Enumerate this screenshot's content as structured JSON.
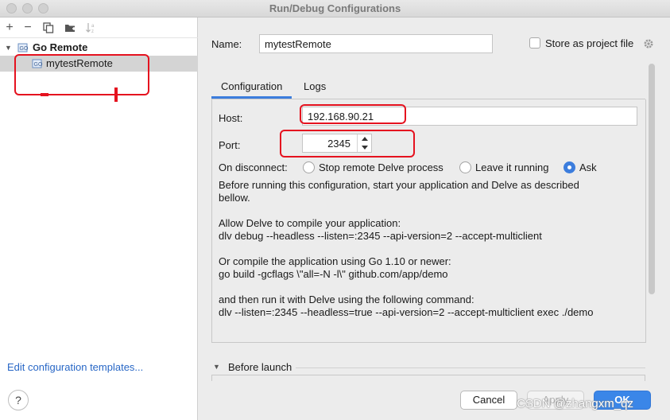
{
  "window": {
    "title": "Run/Debug Configurations"
  },
  "sidebar": {
    "group_label": "Go Remote",
    "selected_item": "mytestRemote",
    "edit_templates_link": "Edit configuration templates..."
  },
  "form": {
    "name_label": "Name:",
    "name_value": "mytestRemote",
    "store_label": "Store as project file",
    "tabs": [
      {
        "label": "Configuration",
        "active": true
      },
      {
        "label": "Logs",
        "active": false
      }
    ],
    "host_label": "Host:",
    "host_value": "192.168.90.21",
    "port_label": "Port:",
    "port_value": "2345",
    "disconnect_label": "On disconnect:",
    "disconnect_options": [
      {
        "label": "Stop remote Delve process",
        "checked": false
      },
      {
        "label": "Leave it running",
        "checked": false
      },
      {
        "label": "Ask",
        "checked": true
      }
    ],
    "description": {
      "intro": "Before running this configuration, start your application and Delve as described\nbellow.",
      "allow_title": "Allow Delve to compile your application:",
      "allow_cmd": "dlv debug --headless --listen=:2345 --api-version=2 --accept-multiclient",
      "compile_title": "Or compile the application using Go 1.10 or newer:",
      "compile_cmd": "go build -gcflags \\\"all=-N -l\\\" github.com/app/demo",
      "run_title": "and then run it with Delve using the following command:",
      "run_cmd": "dlv --listen=:2345 --headless=true --api-version=2 --accept-multiclient exec ./demo"
    },
    "before_launch_label": "Before launch"
  },
  "footer": {
    "help_label": "?",
    "cancel_label": "Cancel",
    "apply_label": "Apply",
    "ok_label": "OK"
  },
  "watermark": "CSDN @zhangxm_qz",
  "colors": {
    "accent": "#3c7ddd",
    "annotation": "#e5121f",
    "link": "#2867c6"
  }
}
